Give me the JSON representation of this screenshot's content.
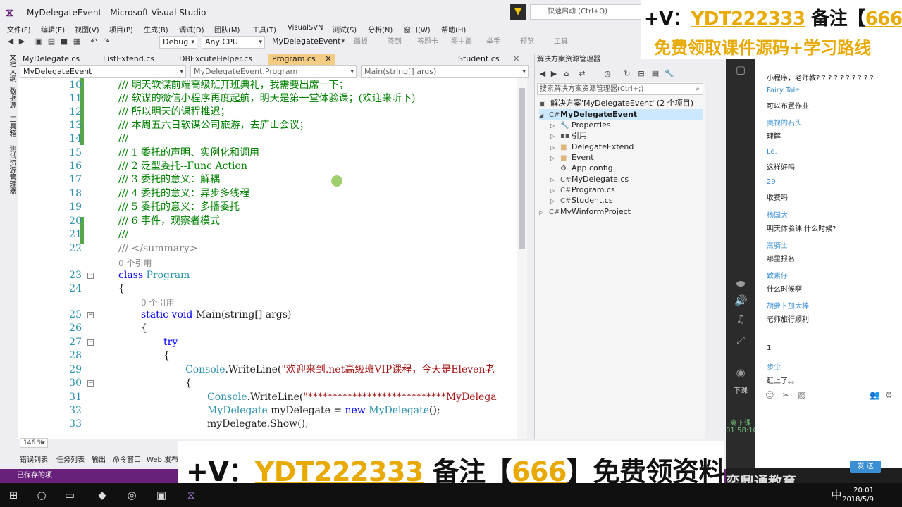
{
  "window": {
    "title": "MyDelegateEvent - Microsoft Visual Studio",
    "quick_launch": "快速启动 (Ctrl+Q)"
  },
  "menu": [
    "文件(F)",
    "编辑(E)",
    "视图(V)",
    "项目(P)",
    "生成(B)",
    "调试(D)",
    "团队(M)",
    "工具(T)",
    "VisualSVN",
    "测试(S)",
    "分析(N)",
    "窗口(W)",
    "帮助(H)"
  ],
  "toolbar": {
    "config": "Debug",
    "platform": "Any CPU",
    "startup": "MyDelegateEvent",
    "extra": [
      "画板",
      "签到",
      "答题卡",
      "图中画",
      "举手",
      "预览",
      "工具"
    ]
  },
  "left_tabs": [
    "文档大纲",
    "数据源",
    "工具箱",
    "测试资源管理器"
  ],
  "doc_tabs": [
    "MyDelegate.cs",
    "ListExtend.cs",
    "DBExcuteHelper.cs",
    "Program.cs",
    "Student.cs"
  ],
  "navbar": {
    "project": "MyDelegateEvent",
    "class": "MyDelegateEvent.Program",
    "member": "Main(string[] args)"
  },
  "code": {
    "l10": "/// 明天软谋前端高级班开班典礼，我需要出席一下；",
    "l11": "/// 软谋的微信小程序再度起航，明天是第一堂体验课；(欢迎来听下)",
    "l12": "/// 所以明天的课程推迟；",
    "l13": "/// 本周五六日软谋公司旅游，去庐山会议；",
    "l14": "///",
    "l15": "/// 1 委托的声明、实例化和调用",
    "l16": "/// 2 泛型委托--Func Action",
    "l17": "/// 3 委托的意义：解耦",
    "l18": "/// 4 委托的意义：异步多线程",
    "l19": "/// 5 委托的意义：多播委托",
    "l20": "/// 6 事件，观察者模式",
    "l21": "///",
    "l22": "/// </summary>",
    "ref": "0 个引用",
    "l23_kw": "class",
    "l23_ty": "Program",
    "l24": "{",
    "l25_kw": "static void",
    "l25_rest": "Main(string[] args)",
    "l26": "{",
    "l27": "try",
    "l28": "{",
    "l29_ty": "Console",
    "l29_m": ".WriteLine(",
    "l29_s": "\"欢迎来到.net高级班VIP课程，今天是Eleven老",
    "l30": "{",
    "l31_ty": "Console",
    "l31_m": ".WriteLine(",
    "l31_s": "\"****************************MyDelega",
    "l32_ty": "MyDelegate",
    "l32_v": " myDelegate = ",
    "l32_kw": "new",
    "l32_ty2": " MyDelegate",
    "l32_e": "();",
    "l33": "myDelegate.Show();"
  },
  "line_numbers": [
    "10",
    "11",
    "12",
    "13",
    "14",
    "15",
    "16",
    "17",
    "18",
    "19",
    "20",
    "21",
    "22",
    "23",
    "24",
    "25",
    "26",
    "27",
    "28",
    "29",
    "30",
    "31",
    "32",
    "33"
  ],
  "zoom": "146 %",
  "bottom_tabs": [
    "错误列表",
    "任务列表",
    "输出",
    "命令窗口",
    "Web 发布"
  ],
  "status": "已保存的项",
  "solution_explorer": {
    "title": "解决方案资源管理器",
    "search": "搜索解决方案资源管理器(Ctrl+;)",
    "solution": "解决方案'MyDelegateEvent' (2 个项目)",
    "project": "MyDelegateEvent",
    "items": [
      "Properties",
      "引用",
      "DelegateExtend",
      "Event",
      "App.config",
      "MyDelegate.cs",
      "Program.cs",
      "Student.cs"
    ],
    "project2": "MyWinformProject"
  },
  "live_side": {
    "down_label": "下课",
    "class_label": "离下课",
    "time": "01:58:10"
  },
  "chat": [
    {
      "name": "",
      "msg": "小程序，老师教? ? ? ? ? ? ? ? ? ?"
    },
    {
      "name": "Fairy Tale",
      "msg": "可以布置作业"
    },
    {
      "name": "奥视的石头",
      "msg": "理解"
    },
    {
      "name": "Le.",
      "msg": "这样好吗"
    },
    {
      "name": "29",
      "msg": "收费吗"
    },
    {
      "name": "杨国大",
      "msg": "明天体验课 什么时候?"
    },
    {
      "name": "黑骑士",
      "msg": "哪里报名"
    },
    {
      "name": "致素仔",
      "msg": "什么时候啊"
    },
    {
      "name": "胡萝卜加大棒",
      "msg": "老师旅行顺利"
    },
    {
      "name": "",
      "msg": "1"
    },
    {
      "name": "步尘",
      "msg": "赶上了。。"
    }
  ],
  "send_button": "发 送",
  "banner_top": {
    "line1_a": "+V：",
    "line1_b": "YDT222333",
    "line1_c": " 备注【",
    "line1_d": "666",
    "line1_e": "】",
    "line2": "免费领取课件源码+学习路线"
  },
  "banner_bottom": {
    "a": "+V：",
    "b": "YDT222333",
    "c": " 备注【",
    "d": "666",
    "e": "】免费领资料"
  },
  "watermark": "奕鼎通教育",
  "clock": {
    "time": "20:01",
    "date": "2018/5/9"
  },
  "colors": {
    "accent": "#68217a",
    "banner": "#e8a900",
    "comment": "#008000",
    "keyword": "#0000ff",
    "type": "#2b91af"
  }
}
